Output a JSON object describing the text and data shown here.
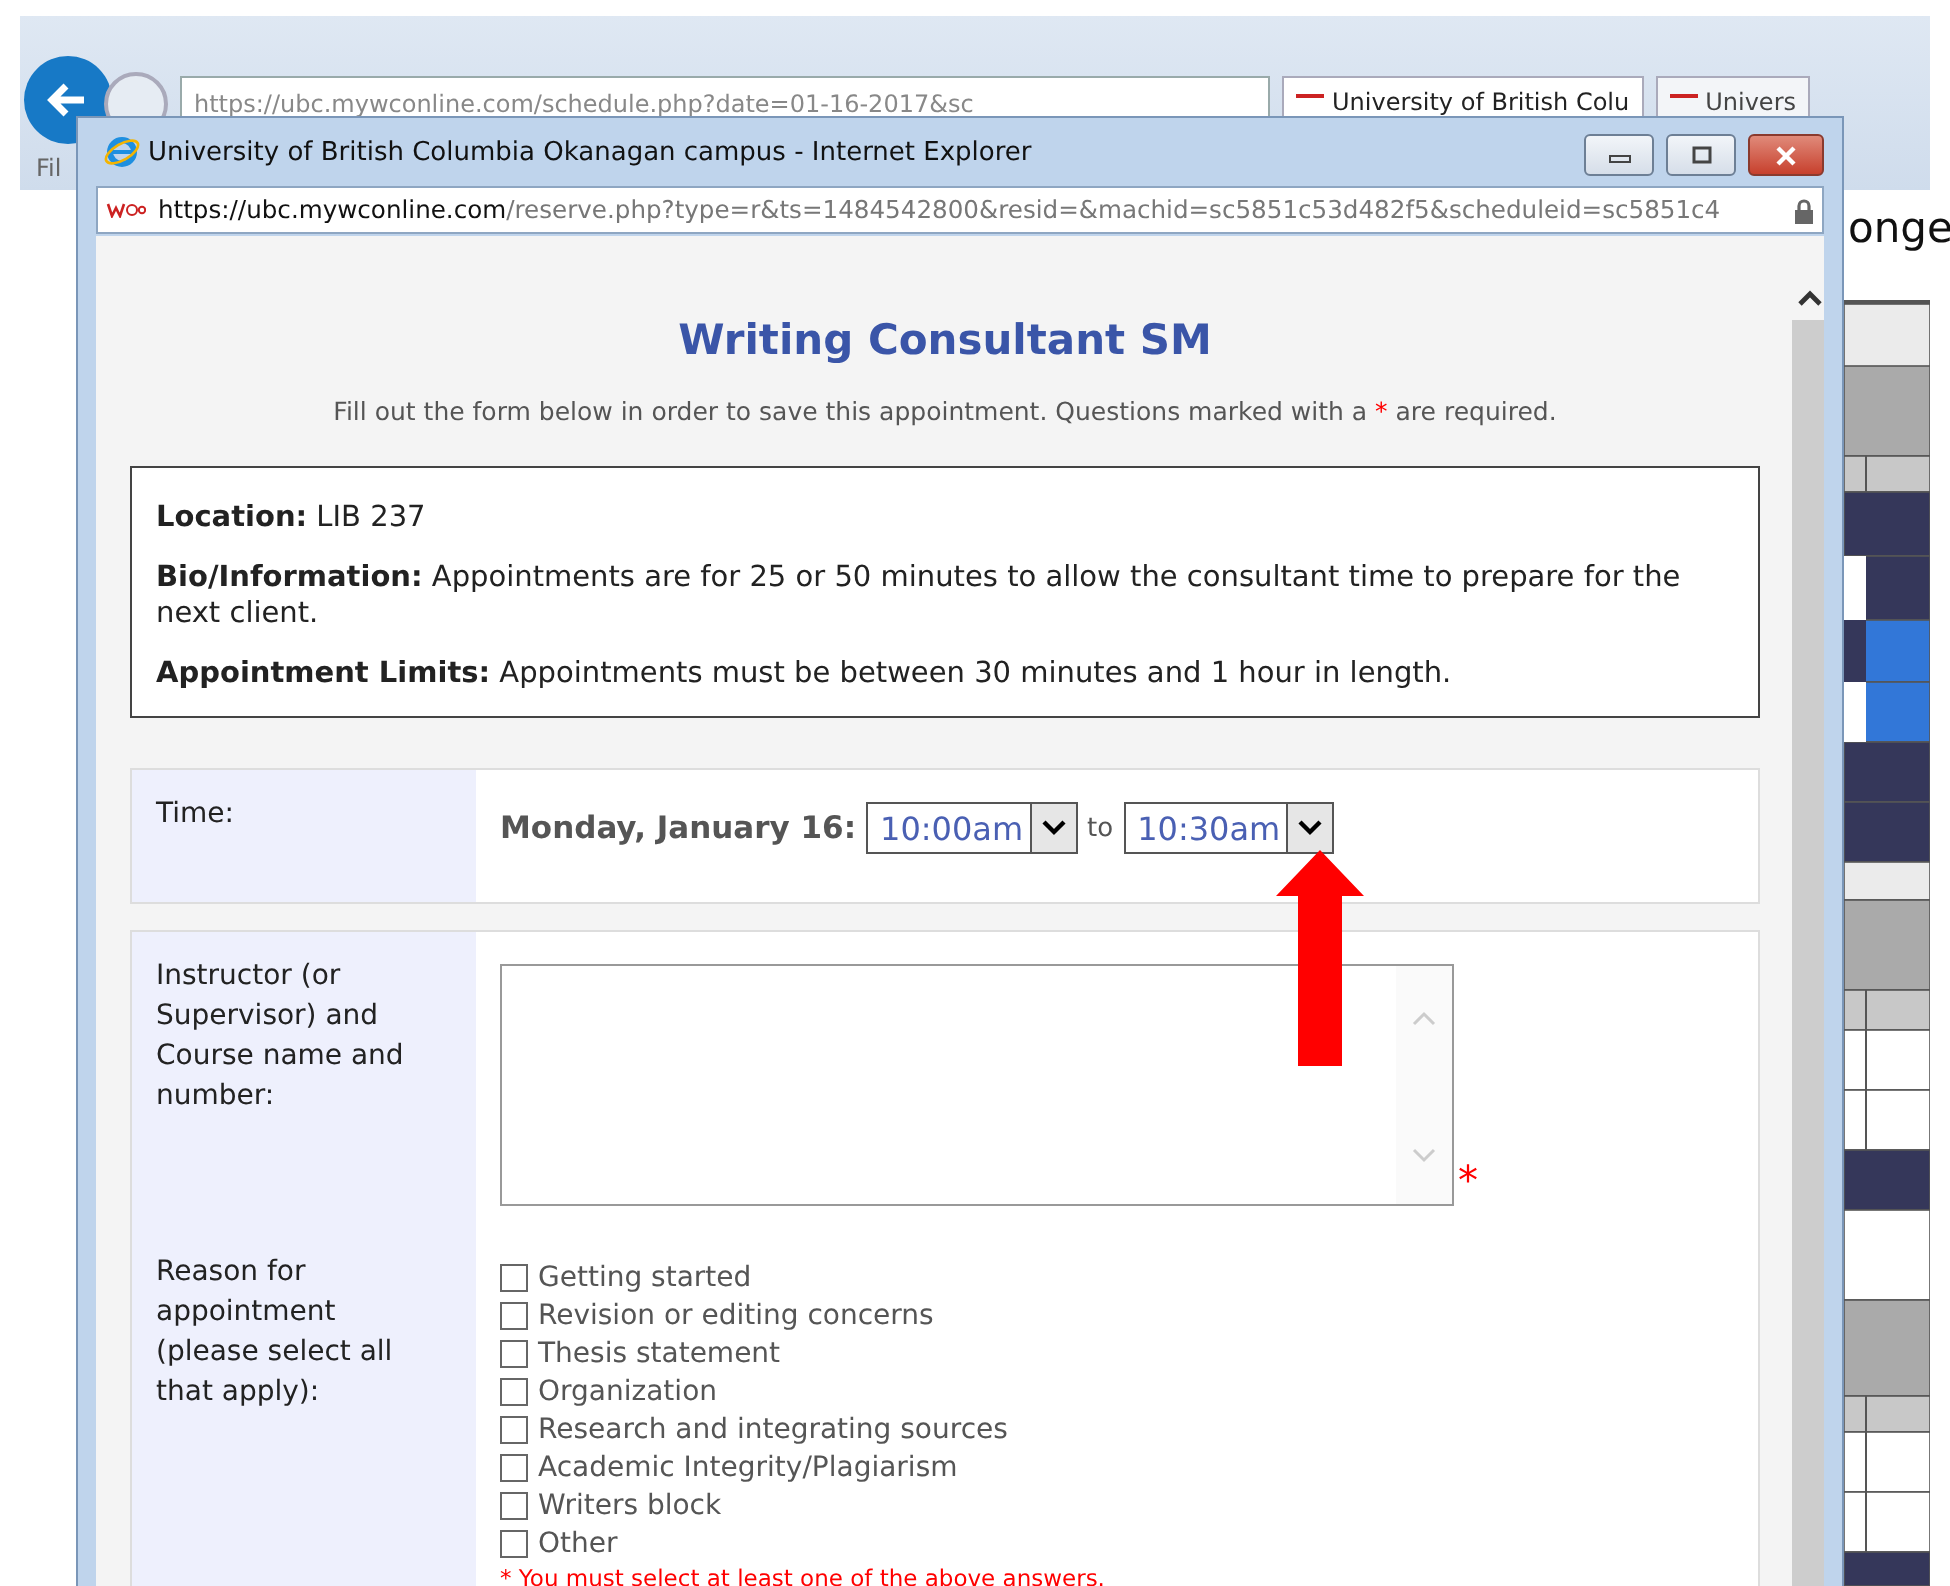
{
  "background_browser": {
    "address": "https://ubc.mywconline.com/schedule.php?date=01-16-2017&sc",
    "tabs": [
      {
        "label": "University of British Colu",
        "selected": true
      },
      {
        "label": "Univers",
        "selected": false
      }
    ],
    "menu": "Fil",
    "page_heading": "onge"
  },
  "popup": {
    "title": "University of British Columbia Okanagan campus - Internet Explorer",
    "address_host": "https://ubc.mywconline.com",
    "address_path": "/reserve.php?type=r&ts=1484542800&resid=&machid=sc5851c53d482f5&scheduleid=sc5851c4",
    "heading": "Writing Consultant SM",
    "intro_start": "Fill out the form below in order to save this appointment. Questions marked with a",
    "required_mark": "*",
    "intro_end": "are required.",
    "info": [
      {
        "label": "Location:",
        "text": "LIB 237"
      },
      {
        "label": "Bio/Information:",
        "text": "Appointments are for 25 or 50 minutes to allow the consultant time to prepare for the next client."
      },
      {
        "label": "Appointment Limits:",
        "text": "Appointments must be between 30 minutes and 1 hour in length."
      }
    ],
    "time": {
      "label": "Time:",
      "date": "Monday, January 16:",
      "start": "10:00am",
      "separator": "to",
      "end": "10:30am"
    },
    "instructor": {
      "label": "Instructor (or Supervisor) and Course name and number:",
      "required_mark": "*"
    },
    "reason": {
      "label": "Reason for appointment (please select all that apply):",
      "options": [
        {
          "label": "Getting started",
          "checked": false
        },
        {
          "label": "Revision or editing concerns",
          "checked": false
        },
        {
          "label": "Thesis statement",
          "checked": false
        },
        {
          "label": "Organization",
          "checked": false
        },
        {
          "label": "Research and integrating sources",
          "checked": false
        },
        {
          "label": "Academic Integrity/Plagiarism",
          "checked": false
        },
        {
          "label": "Writers block",
          "checked": false
        },
        {
          "label": "Other",
          "checked": false
        }
      ],
      "error": "* You must select at least one of the above answers."
    }
  }
}
